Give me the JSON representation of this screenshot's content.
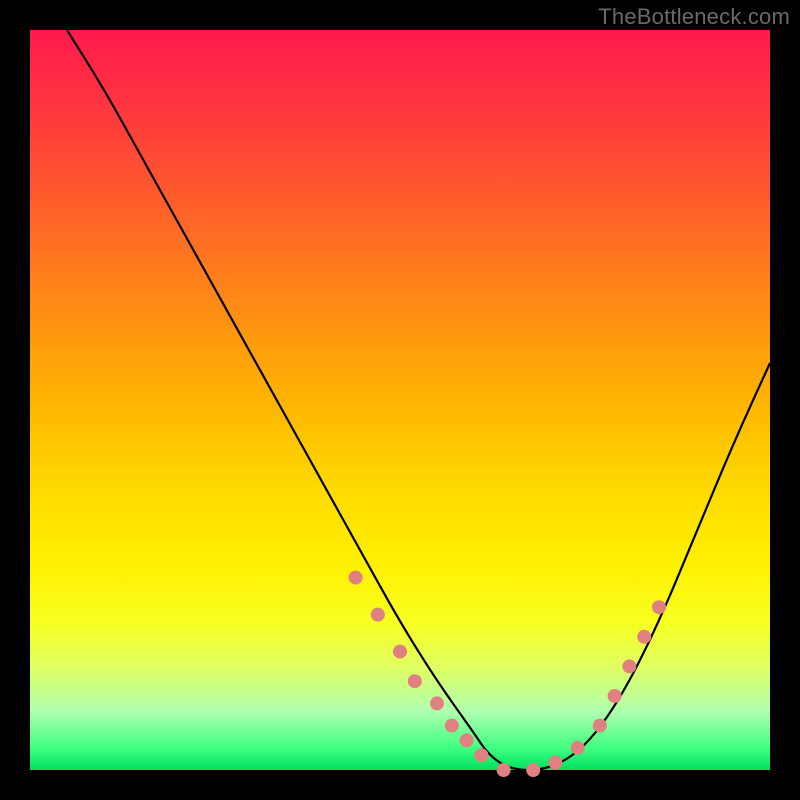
{
  "watermark": "TheBottleneck.com",
  "chart_data": {
    "type": "line",
    "title": "",
    "xlabel": "",
    "ylabel": "",
    "xlim": [
      0,
      100
    ],
    "ylim": [
      0,
      100
    ],
    "grid": false,
    "legend": false,
    "series": [
      {
        "name": "bottleneck-curve",
        "x": [
          5,
          10,
          15,
          20,
          25,
          30,
          35,
          40,
          45,
          50,
          55,
          60,
          62,
          65,
          70,
          75,
          80,
          85,
          90,
          95,
          100
        ],
        "y": [
          100,
          92,
          83,
          74,
          65,
          56,
          47,
          38,
          29,
          20,
          12,
          5,
          2,
          0,
          0,
          3,
          10,
          20,
          32,
          44,
          55
        ]
      }
    ],
    "markers": {
      "name": "highlight-dots",
      "x": [
        44,
        47,
        50,
        52,
        55,
        57,
        59,
        61,
        64,
        68,
        71,
        74,
        77,
        79,
        81,
        83,
        85
      ],
      "y": [
        26,
        21,
        16,
        12,
        9,
        6,
        4,
        2,
        0,
        0,
        1,
        3,
        6,
        10,
        14,
        18,
        22
      ]
    },
    "gradient_stops": [
      {
        "pos": 0,
        "color": "#ff1a4d"
      },
      {
        "pos": 50,
        "color": "#ffba00"
      },
      {
        "pos": 80,
        "color": "#f8ff20"
      },
      {
        "pos": 100,
        "color": "#00e060"
      }
    ]
  }
}
